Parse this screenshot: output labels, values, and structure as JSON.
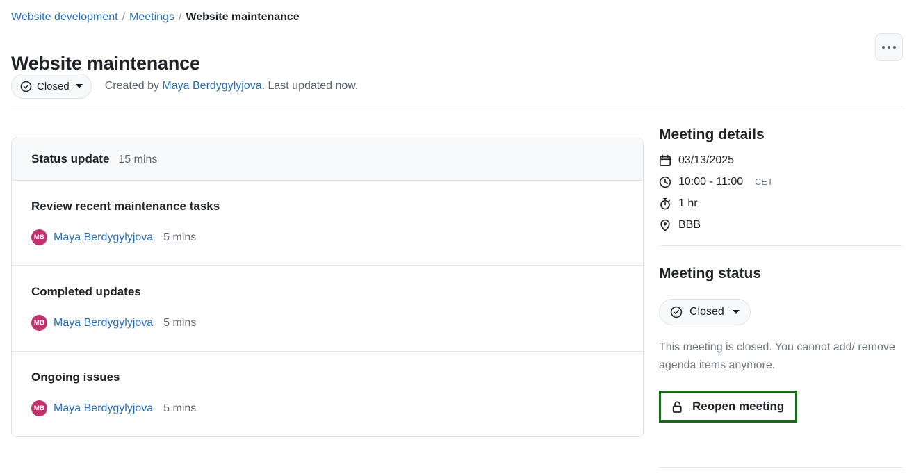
{
  "breadcrumb": {
    "items": [
      {
        "label": "Website development",
        "current": false
      },
      {
        "label": "Meetings",
        "current": false
      },
      {
        "label": "Website maintenance",
        "current": true
      }
    ],
    "separator": "/"
  },
  "header": {
    "title": "Website maintenance",
    "status_label": "Closed",
    "status_icon": "check-circle-icon",
    "created_prefix": "Created by ",
    "author": "Maya Berdygylyjova",
    "created_suffix": ". Last updated now.",
    "more_menu_icon": "kebab-horizontal-icon"
  },
  "agenda": {
    "section_title": "Status update",
    "section_duration": "15 mins",
    "items": [
      {
        "title": "Review recent maintenance tasks",
        "avatar_initials": "MB",
        "person": "Maya Berdygylyjova",
        "duration": "5 mins"
      },
      {
        "title": "Completed updates",
        "avatar_initials": "MB",
        "person": "Maya Berdygylyjova",
        "duration": "5 mins"
      },
      {
        "title": "Ongoing issues",
        "avatar_initials": "MB",
        "person": "Maya Berdygylyjova",
        "duration": "5 mins"
      }
    ]
  },
  "sidebar": {
    "details_heading": "Meeting details",
    "date": "03/13/2025",
    "date_icon": "calendar-icon",
    "time_range": "10:00 - 11:00",
    "time_icon": "clock-icon",
    "timezone": "CET",
    "duration": "1 hr",
    "duration_icon": "stopwatch-icon",
    "location": "BBB",
    "location_icon": "location-pin-icon",
    "status_heading": "Meeting status",
    "status_value": "Closed",
    "status_icon": "check-circle-icon",
    "closed_note": "This meeting is closed. You cannot add/ remove agenda items anymore.",
    "reopen_label": "Reopen meeting",
    "reopen_icon": "unlock-icon"
  },
  "colors": {
    "link": "#2a6fb3",
    "avatar": "#c2326f",
    "highlight_border": "#1b6b1b",
    "muted_text": "#6e7781",
    "card_header_bg": "#f6f8fa",
    "border": "#dfe3e8"
  }
}
